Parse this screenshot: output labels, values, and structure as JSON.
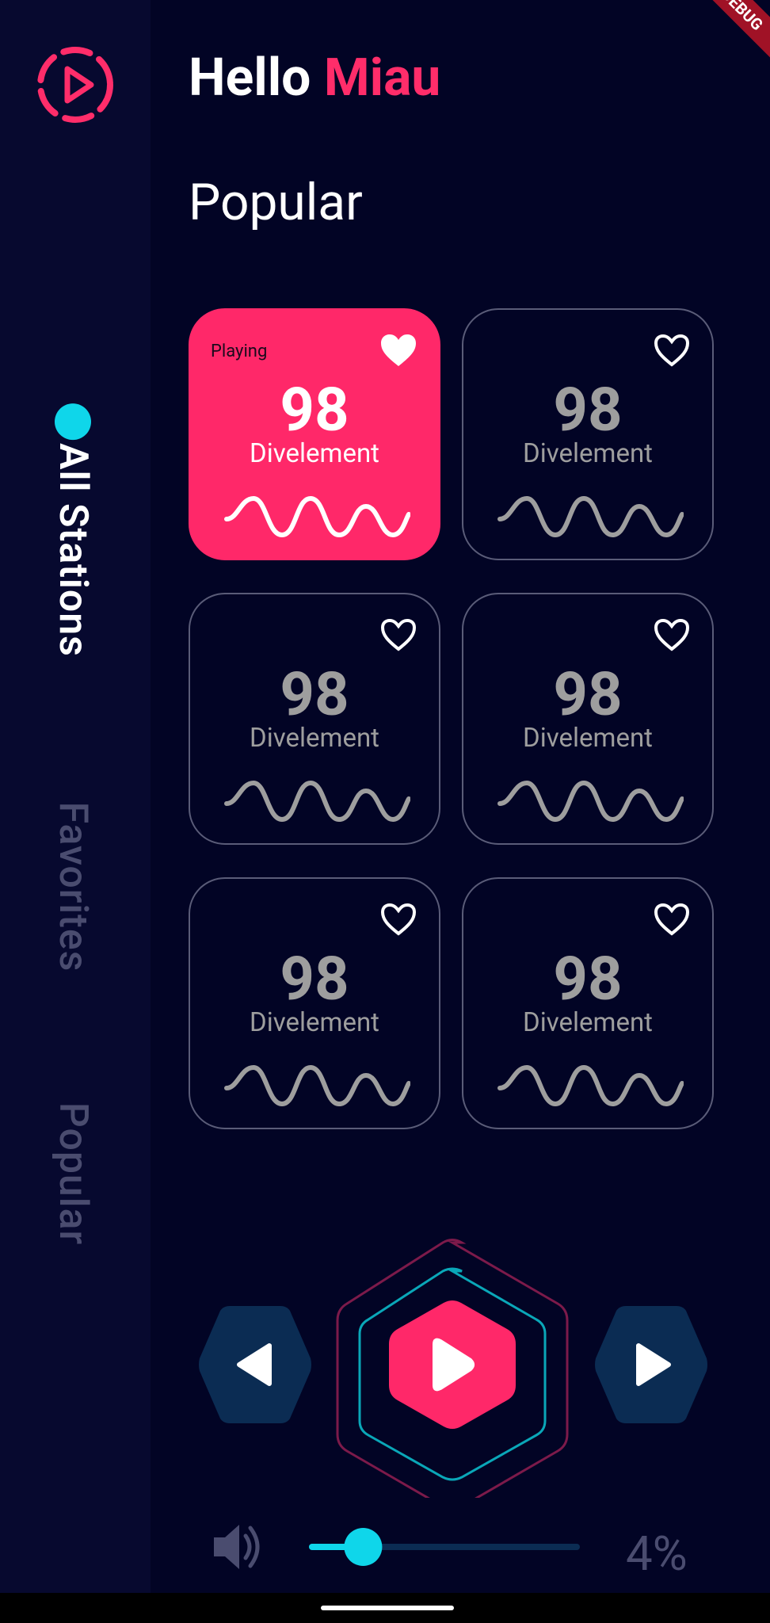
{
  "header": {
    "greeting": "Hello",
    "user_name": "Miau"
  },
  "section_title": "Popular",
  "sidebar": {
    "logo_icon": "play-circle-icon",
    "items": [
      {
        "label": "All Stations",
        "active": true
      },
      {
        "label": "Favorites",
        "active": false
      },
      {
        "label": "Popular",
        "active": false
      }
    ]
  },
  "stations": [
    {
      "frequency": "98",
      "name": "Divelement",
      "status": "Playing",
      "favorite": true,
      "playing": true
    },
    {
      "frequency": "98",
      "name": "Divelement",
      "favorite": false,
      "playing": false
    },
    {
      "frequency": "98",
      "name": "Divelement",
      "favorite": false,
      "playing": false
    },
    {
      "frequency": "98",
      "name": "Divelement",
      "favorite": false,
      "playing": false
    },
    {
      "frequency": "98",
      "name": "Divelement",
      "favorite": false,
      "playing": false
    },
    {
      "frequency": "98",
      "name": "Divelement",
      "favorite": false,
      "playing": false
    }
  ],
  "player": {
    "prev_icon": "previous-icon",
    "play_icon": "play-icon",
    "next_icon": "next-icon"
  },
  "volume": {
    "icon": "speaker-icon",
    "level": 0.2,
    "percent_label": "4%"
  },
  "debug_banner": "DEBUG",
  "colors": {
    "background": "#020425",
    "sidebar": "#07092f",
    "accent": "#ff2869",
    "cyan": "#0fd6ea",
    "navy": "#0b2c53"
  }
}
